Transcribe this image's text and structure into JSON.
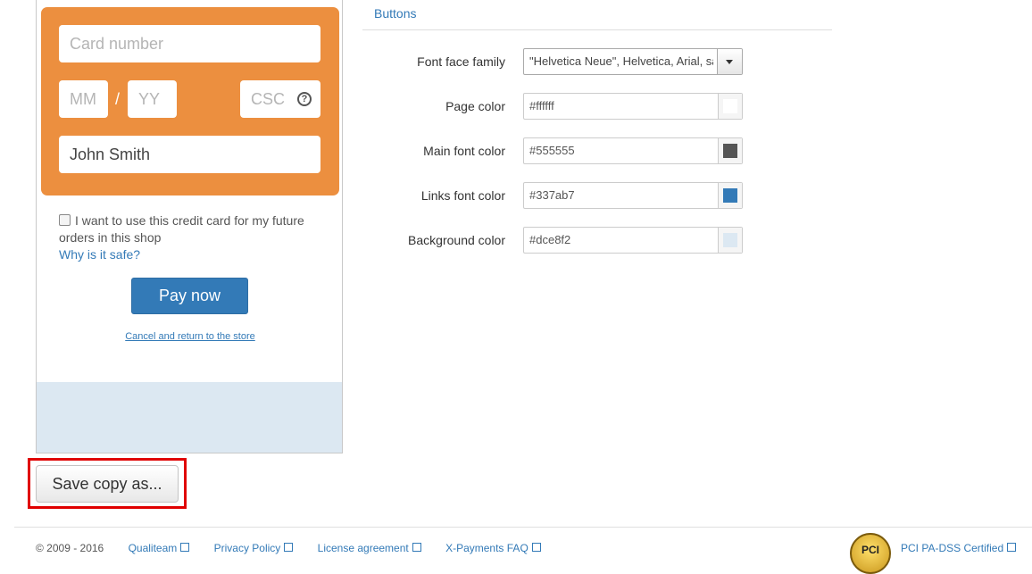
{
  "preview": {
    "card_number_placeholder": "Card number",
    "mm_placeholder": "MM",
    "slash": "/",
    "yy_placeholder": "YY",
    "csc_placeholder": "CSC",
    "help_glyph": "?",
    "cardholder_name": "John Smith",
    "remember_text": "I want to use this credit card for my future orders in this shop",
    "why_safe_link": "Why is it safe?",
    "pay_button": "Pay now",
    "cancel_link": "Cancel and return to the store",
    "card_box_color": "#ec8f3f"
  },
  "save_copy_button": "Save copy as...",
  "settings": {
    "tab_label": "Buttons",
    "font_face": {
      "label": "Font face family",
      "value": "\"Helvetica Neue\", Helvetica, Arial, sans-serif"
    },
    "page_color": {
      "label": "Page color",
      "value": "#ffffff"
    },
    "main_font_color": {
      "label": "Main font color",
      "value": "#555555"
    },
    "links_font_color": {
      "label": "Links font color",
      "value": "#337ab7"
    },
    "background_color": {
      "label": "Background color",
      "value": "#dce8f2"
    }
  },
  "footer": {
    "copyright": "© 2009 - 2016",
    "links": [
      "Qualiteam",
      "Privacy Policy",
      "License agreement",
      "X-Payments FAQ"
    ],
    "pci_badge": "PCI",
    "pci_link": "PCI PA-DSS Certified"
  }
}
